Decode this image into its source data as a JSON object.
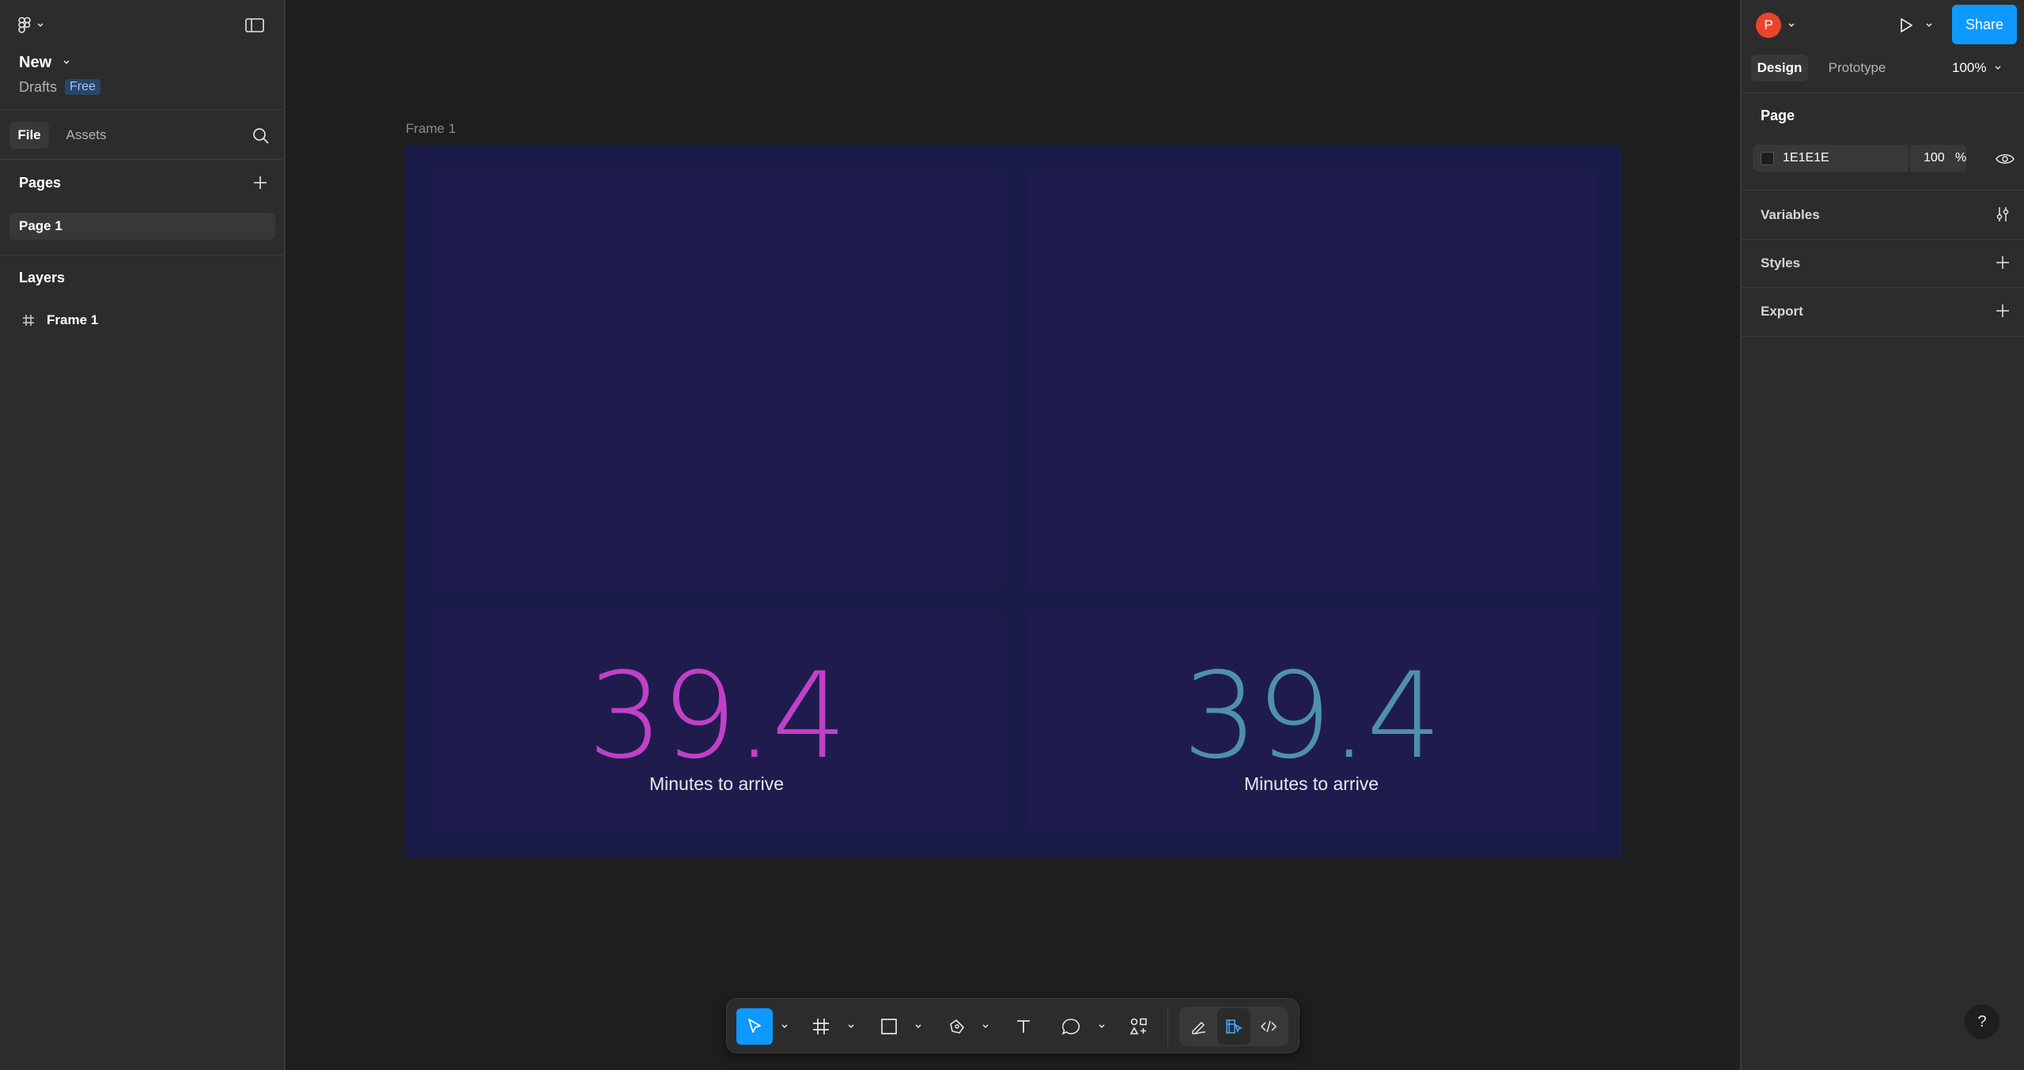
{
  "left_panel": {
    "file_name": "New",
    "location": "Drafts",
    "plan_badge": "Free",
    "tabs": [
      "File",
      "Assets"
    ],
    "pages_heading": "Pages",
    "pages": [
      "Page 1"
    ],
    "layers_heading": "Layers",
    "layers": [
      "Frame 1"
    ]
  },
  "canvas": {
    "frame_label": "Frame 1",
    "cards": [
      {
        "value": "39.4",
        "label": "Minutes to arrive",
        "color": "#c040c8"
      },
      {
        "value": "39.4",
        "label": "Minutes to arrive",
        "color": "#4f8fb0"
      }
    ]
  },
  "right_panel": {
    "avatar_initial": "P",
    "share_label": "Share",
    "tabs": [
      "Design",
      "Prototype"
    ],
    "zoom": "100%",
    "page_heading": "Page",
    "page_color": "1E1E1E",
    "page_opacity": "100",
    "percent_sign": "%",
    "sections": [
      "Variables",
      "Styles",
      "Export"
    ],
    "help": "?"
  },
  "colors": {
    "accent": "#0d99ff",
    "avatar": "#e8442e",
    "frame_bg": "#1b1b49",
    "panel_bg": "#2c2c2c",
    "canvas_bg": "#1e1e1e"
  },
  "icons": {
    "menu": "figma-logo-icon",
    "sidebar": "sidebar-toggle-icon",
    "search": "search-icon",
    "frame": "frame-hash-icon",
    "play": "play-icon"
  }
}
